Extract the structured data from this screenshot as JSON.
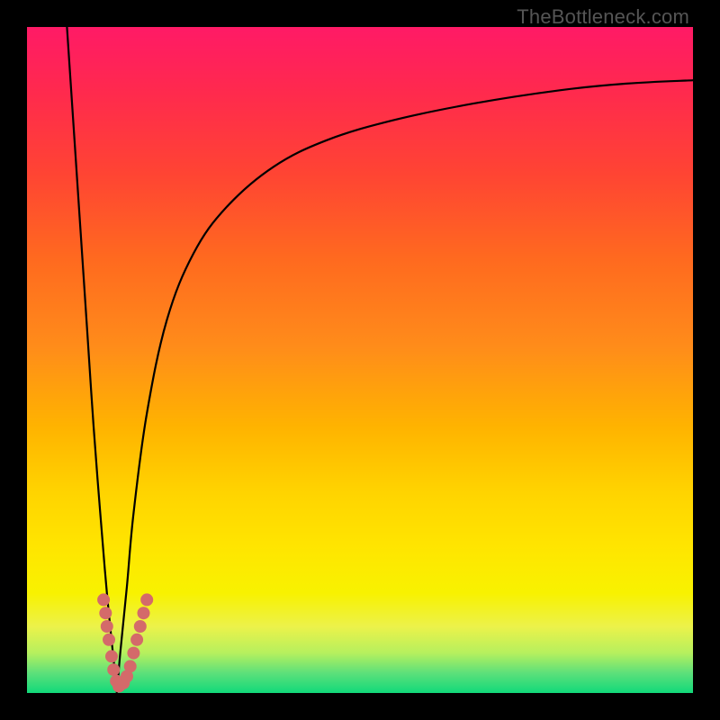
{
  "watermark": "TheBottleneck.com",
  "colors": {
    "frame": "#000000",
    "gradient_top": "#ff1a66",
    "gradient_bottom": "#11d97a",
    "curve": "#000000",
    "dots": "#d46a6a"
  },
  "chart_data": {
    "type": "line",
    "title": "",
    "xlabel": "",
    "ylabel": "",
    "xlim": [
      0,
      100
    ],
    "ylim": [
      0,
      100
    ],
    "series": [
      {
        "name": "left-branch",
        "x": [
          6,
          7,
          8,
          9,
          10,
          11,
          12,
          13,
          13.5
        ],
        "values": [
          100,
          85,
          70,
          55,
          40,
          27,
          15,
          5,
          0
        ]
      },
      {
        "name": "right-branch",
        "x": [
          13.5,
          14,
          15,
          16,
          18,
          21,
          25,
          30,
          37,
          45,
          55,
          67,
          80,
          90,
          100
        ],
        "values": [
          0,
          6,
          16,
          27,
          42,
          56,
          66,
          73,
          79,
          83,
          86,
          88.5,
          90.5,
          91.5,
          92
        ]
      }
    ],
    "scatter": {
      "name": "dots-near-valley",
      "points": [
        {
          "x": 11.5,
          "y": 14
        },
        {
          "x": 11.8,
          "y": 12
        },
        {
          "x": 12.0,
          "y": 10
        },
        {
          "x": 12.3,
          "y": 8
        },
        {
          "x": 12.7,
          "y": 5.5
        },
        {
          "x": 13.0,
          "y": 3.5
        },
        {
          "x": 13.4,
          "y": 1.8
        },
        {
          "x": 13.8,
          "y": 1.0
        },
        {
          "x": 14.5,
          "y": 1.5
        },
        {
          "x": 15.0,
          "y": 2.5
        },
        {
          "x": 15.5,
          "y": 4
        },
        {
          "x": 16.0,
          "y": 6
        },
        {
          "x": 16.5,
          "y": 8
        },
        {
          "x": 17.0,
          "y": 10
        },
        {
          "x": 17.5,
          "y": 12
        },
        {
          "x": 18.0,
          "y": 14
        }
      ]
    }
  }
}
